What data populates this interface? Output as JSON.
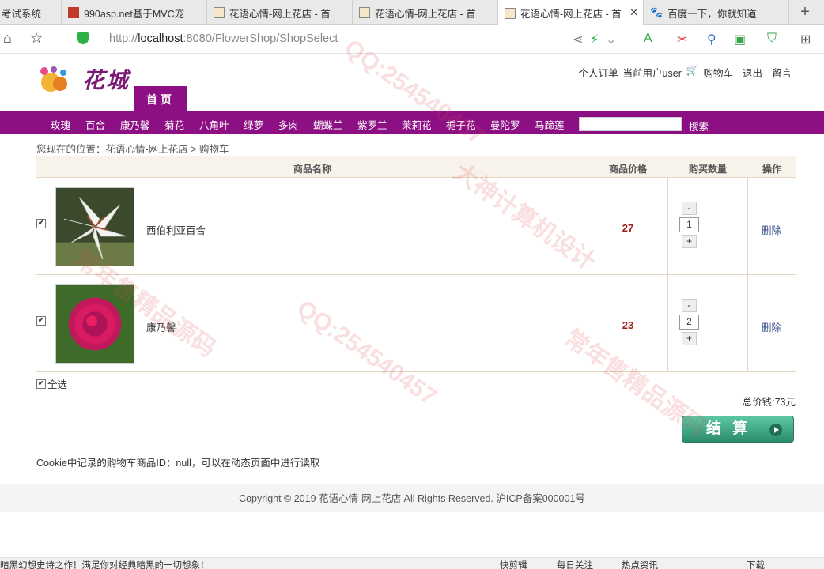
{
  "browser": {
    "tabs": [
      {
        "title": "考试系统"
      },
      {
        "title": "990asp.net基于MVC宠"
      },
      {
        "title": "花语心情-网上花店 - 首"
      },
      {
        "title": "花语心情-网上花店 - 首"
      },
      {
        "title": "花语心情-网上花店 - 首"
      },
      {
        "title": "百度一下，你就知道"
      }
    ],
    "url": {
      "prefix": "http://",
      "host": "localhost",
      "rest": ":8080/FlowerShop/ShopSelect"
    }
  },
  "header": {
    "logo_text": "花城",
    "home_tab": "首页",
    "links": [
      "个人订单",
      "当前用户user",
      "购物车",
      "退出",
      "留言"
    ]
  },
  "categories": [
    "玫瑰",
    "百合",
    "康乃馨",
    "菊花",
    "八角叶",
    "绿萝",
    "多肉",
    "蝴蝶兰",
    "紫罗兰",
    "茉莉花",
    "栀子花",
    "曼陀罗",
    "马蹄莲"
  ],
  "search": {
    "button": "搜索",
    "value": ""
  },
  "breadcrumb": "您现在的位置：花语心情-网上花店 > 购物车",
  "cart": {
    "headers": {
      "name": "商品名称",
      "price": "商品价格",
      "qty": "购买数量",
      "op": "操作"
    },
    "items": [
      {
        "name": "西伯利亚百合",
        "price": "27",
        "qty": "1",
        "delete": "删除"
      },
      {
        "name": "康乃馨",
        "price": "23",
        "qty": "2",
        "delete": "删除"
      }
    ],
    "select_all": "全选",
    "total": "总价钱:73元",
    "checkout": "结算"
  },
  "cookie_note": "Cookie中记录的购物车商品ID：null，可以在动态页面中进行读取",
  "footer": "Copyright © 2019 花语心情-网上花店 All Rights Reserved. 沪ICP备案000001号",
  "status": {
    "left": "暗黑幻想史诗之作！满足你对经典暗黑的一切想象！",
    "items": [
      "快剪辑",
      "每日关注",
      "热点资讯",
      "下载"
    ]
  },
  "watermarks": [
    "QQ:254540457",
    "大神计算机设计",
    "常年售精品源码"
  ]
}
